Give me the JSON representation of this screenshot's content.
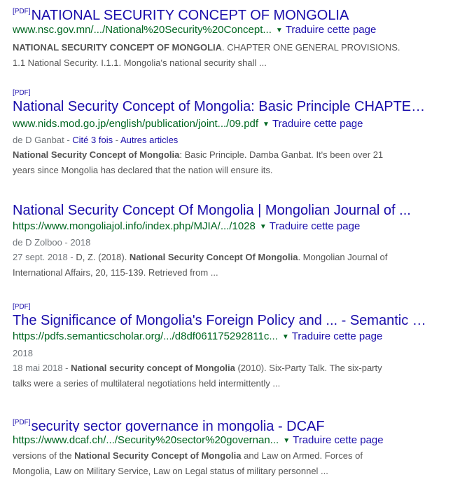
{
  "results": [
    {
      "pdf_tag": "[PDF]",
      "title": "NATIONAL SECURITY CONCEPT OF MONGOLIA",
      "url": "www.nsc.gov.mn/.../National%20Security%20Concept...",
      "translate": "Traduire cette page",
      "snippet_b1": "NATIONAL SECURITY CONCEPT OF MONGOLIA",
      "snippet_t1": ". CHAPTER ONE GENERAL PROVISIONS.",
      "snippet_l2": "1.1 National Security. I.1.1. Mongolia's national security shall ..."
    },
    {
      "pdf_tag": "[PDF]",
      "title": "National Security Concept of Mongolia: Basic Principle CHAPTE…",
      "url": "www.nids.mod.go.jp/english/publication/joint.../09.pdf",
      "translate": "Traduire cette page",
      "meta_prefix": "de D Ganbat - ",
      "meta_cited": "Cité 3 fois",
      "meta_sep": " - ",
      "meta_other": "Autres articles",
      "snippet_b1": "National Security Concept of Mongolia",
      "snippet_t1": ": Basic Principle. Damba Ganbat. It's been over 21",
      "snippet_l2": "years since Mongolia has declared that the nation will ensure its."
    },
    {
      "title": "National Security Concept Of Mongolia | Mongolian Journal of ...",
      "url": "https://www.mongoliajol.info/index.php/MJIA/.../1028",
      "translate": "Traduire cette page",
      "meta": "de D Zolboo - 2018",
      "snippet_date": "27 sept. 2018 - ",
      "snippet_t0": "D, Z. (2018). ",
      "snippet_b1": "National Security Concept Of Mongolia",
      "snippet_t1": ". Mongolian Journal of",
      "snippet_l2": "International Affairs, 20, 115-139. Retrieved from ..."
    },
    {
      "pdf_tag": "[PDF]",
      "title": "The Significance of Mongolia's Foreign Policy and ... - Semantic …",
      "url": "https://pdfs.semanticscholar.org/.../d8df061175292811c...",
      "translate": "Traduire cette page",
      "meta": "2018",
      "snippet_date": "18 mai 2018 - ",
      "snippet_b1": "National security concept of Mongolia",
      "snippet_t1": " (2010). Six-Party Talk. The six-party",
      "snippet_l2": "talks were a series of multilateral negotiations held intermittently ..."
    },
    {
      "pdf_tag": "[PDF]",
      "title": "security sector governance in mongolia - DCAF",
      "url": "https://www.dcaf.ch/.../Security%20sector%20governan...",
      "translate": "Traduire cette page",
      "snippet_t0": "versions of the ",
      "snippet_b1": "National Security Concept of Mongolia",
      "snippet_t1": " and Law on Armed. Forces of",
      "snippet_l2": "Mongolia, Law on Military Service, Law on Legal status of military personnel ..."
    }
  ],
  "icons": {
    "caret": "dropdown-caret-icon"
  },
  "colors": {
    "title": "#1a0dab",
    "url": "#006621",
    "snippet": "#545454",
    "meta": "#70757a"
  }
}
